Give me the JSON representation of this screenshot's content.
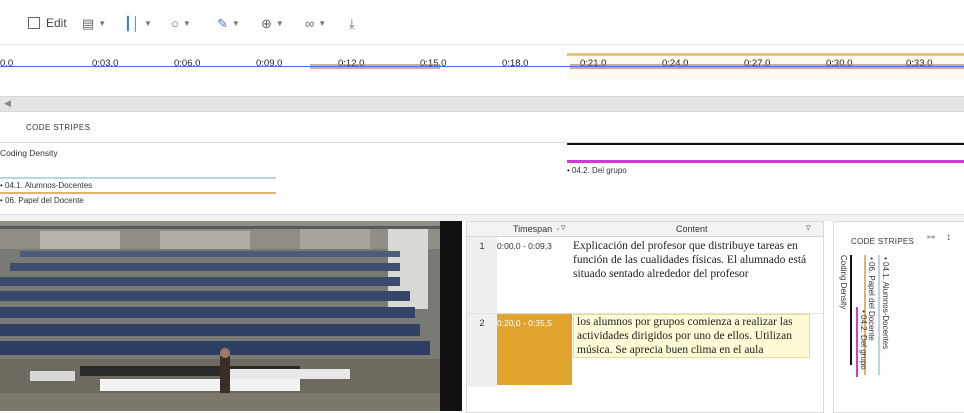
{
  "toolbar": {
    "edit_label": "Edit",
    "icons": [
      "memo-icon",
      "bars-icon",
      "circle-icon",
      "pen-icon",
      "zoom-icon",
      "link-icon",
      "download-icon"
    ]
  },
  "timeline": {
    "ticks": [
      "0,0",
      "0:03,0",
      "0:06,0",
      "0:09,0",
      "0:12,0",
      "0:15,0",
      "0:18,0",
      "0:21,0",
      "0:24,0",
      "0:27,0",
      "0:30,0",
      "0:33,0"
    ]
  },
  "stripes": {
    "title": "CODE STRIPES",
    "density": "Coding Density",
    "grupo": "• 04.2. Del grupo",
    "alumnos": "• 04.1. Alumnos-Docentes",
    "papel": "• 06. Papel del Docente"
  },
  "table": {
    "col_timespan": "Timespan",
    "col_content": "Content",
    "rows": [
      {
        "num": "1",
        "timespan": "0:00,0 - 0:09,3",
        "content": "Explicación del profesor que distribuye tareas en función de las cualidades físicas. El alumnado está situado sentado alrededor del profesor"
      },
      {
        "num": "2",
        "timespan": "0:20,0 - 0:35,5",
        "content": "los alumnos por grupos comienza a realizar las actividades dirigidos por uno de ellos. Utilizan música. Se aprecia buen clima en el aula"
      }
    ]
  },
  "right_panel": {
    "title": "CODE STRIPES",
    "density": "Coding Density",
    "papel": "• 06. Papel del Docente",
    "alumnos": "• 04.1. Alumnos-Docentes",
    "grupo": "• 04.2. Del grupo"
  },
  "colors": {
    "papel": "#e2b36f",
    "alumnos": "#bcd3e2",
    "grupo": "#d339d3",
    "timespan_highlight": "#e0a32e"
  }
}
